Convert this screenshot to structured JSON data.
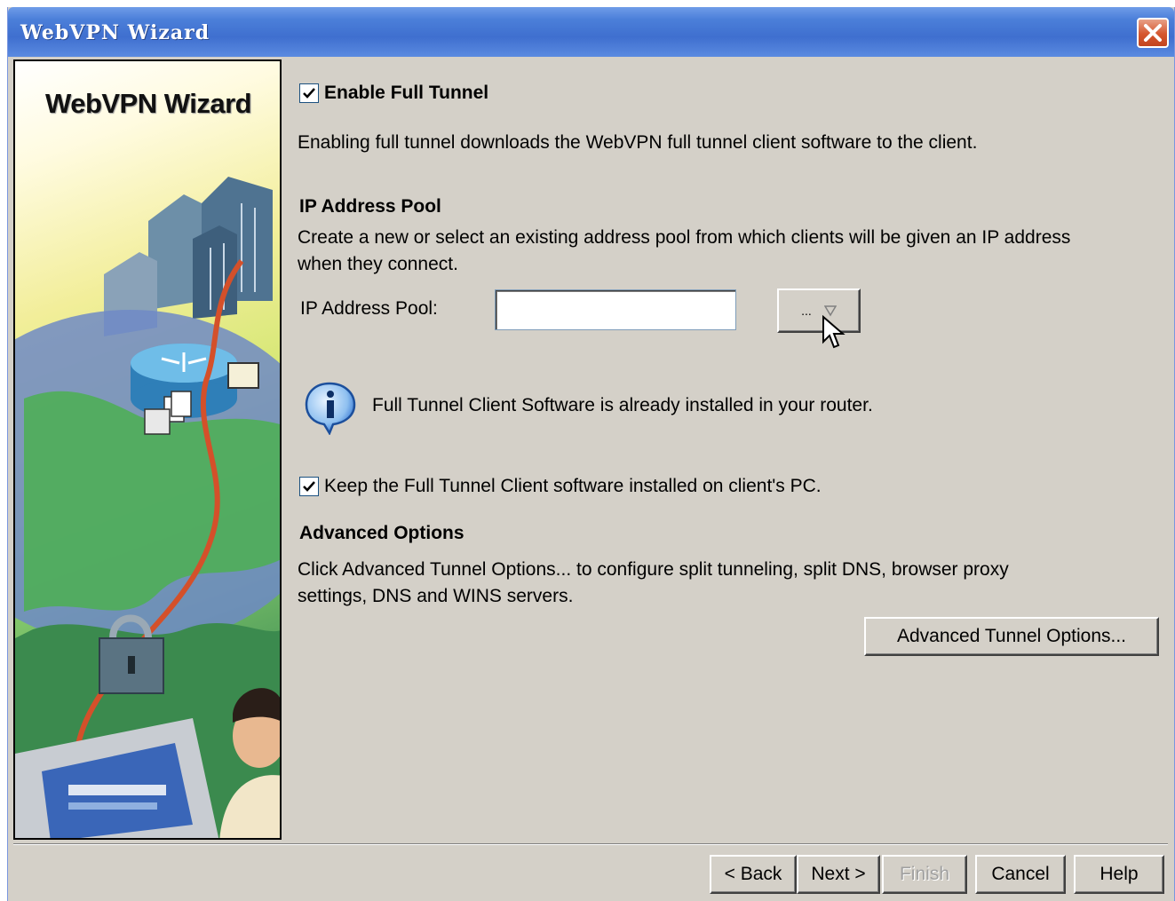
{
  "window": {
    "title": "WebVPN Wizard"
  },
  "side_panel": {
    "title": "WebVPN Wizard"
  },
  "enable_full_tunnel": {
    "label": "Enable Full Tunnel",
    "checked": true
  },
  "description": "Enabling full tunnel downloads the WebVPN full tunnel client software to the client.",
  "ip_pool": {
    "heading": "IP Address Pool",
    "description_line1": "Create a new or select an existing address pool from which clients will be given an IP address",
    "description_line2": "when they connect.",
    "field_label": "IP Address Pool:",
    "value": "",
    "combo_label": "..."
  },
  "info": {
    "message": "Full Tunnel Client Software is already installed in your router."
  },
  "keep_client": {
    "label": "Keep the Full Tunnel Client software installed on client's PC.",
    "checked": true
  },
  "advanced": {
    "heading": "Advanced Options",
    "description_line1": "Click Advanced Tunnel Options... to configure split tunneling, split DNS, browser proxy",
    "description_line2": "settings, DNS and WINS servers.",
    "button_label": "Advanced Tunnel Options..."
  },
  "footer": {
    "back_label": "< Back",
    "next_label": "Next >",
    "finish_label": "Finish",
    "cancel_label": "Cancel",
    "help_label": "Help"
  },
  "colors": {
    "titlebar": "#3f6fcf",
    "dialog_bg": "#d4d0c8",
    "close_button": "#d5562e",
    "info_icon": "#3a7bd5"
  }
}
